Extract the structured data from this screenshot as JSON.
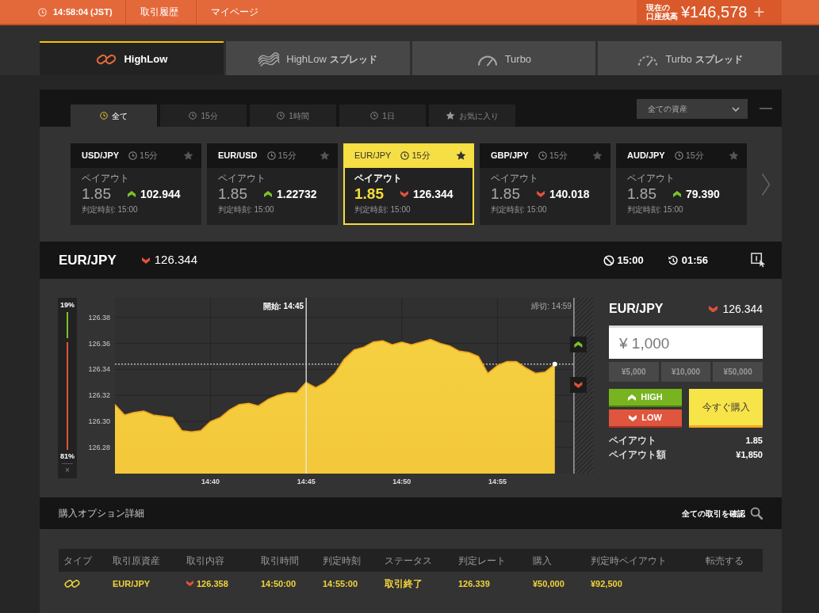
{
  "top_bar": {
    "time": "14:58:04 (JST)",
    "links": [
      "取引履歴",
      "マイページ"
    ],
    "balance": {
      "label_lines": [
        "現在の",
        "口座残高"
      ],
      "amount": "¥146,578",
      "add": "+"
    }
  },
  "product_tabs": [
    {
      "kind": "highlow",
      "label": "HighLow",
      "selected": true
    },
    {
      "kind": "highlow-spread",
      "label": "HighLow",
      "suffix": "スプレッド",
      "selected": false
    },
    {
      "kind": "turbo",
      "label": "Turbo",
      "selected": false
    },
    {
      "kind": "turbo-spread",
      "label": "Turbo",
      "suffix": "スプレッド",
      "selected": false
    }
  ],
  "filter": {
    "tabs": [
      {
        "kind": "clock",
        "label": "全て",
        "selected": true
      },
      {
        "kind": "clock",
        "label": "15分",
        "selected": false
      },
      {
        "kind": "clock",
        "label": "1時間",
        "selected": false
      },
      {
        "kind": "clock",
        "label": "1日",
        "selected": false
      },
      {
        "kind": "star",
        "label": "お気に入り",
        "selected": false
      }
    ],
    "asset_select": "全ての資産"
  },
  "cards": [
    {
      "pair": "USD/JPY",
      "duration": "15分",
      "payout_label": "ペイアウト",
      "payout": "1.85",
      "rising": true,
      "rate": "102.944",
      "expiry": "判定時刻: 15:00",
      "selected": false
    },
    {
      "pair": "EUR/USD",
      "duration": "15分",
      "payout_label": "ペイアウト",
      "payout": "1.85",
      "rising": true,
      "rate": "1.22732",
      "expiry": "判定時刻: 15:00",
      "selected": false
    },
    {
      "pair": "EUR/JPY",
      "duration": "15分",
      "payout_label": "ペイアウト",
      "payout": "1.85",
      "rising": false,
      "rate": "126.344",
      "expiry": "判定時刻: 15:00",
      "selected": true
    },
    {
      "pair": "GBP/JPY",
      "duration": "15分",
      "payout_label": "ペイアウト",
      "payout": "1.85",
      "rising": false,
      "rate": "140.018",
      "expiry": "判定時刻: 15:00",
      "selected": false
    },
    {
      "pair": "AUD/JPY",
      "duration": "15分",
      "payout_label": "ペイアウト",
      "payout": "1.85",
      "rising": true,
      "rate": "79.390",
      "expiry": "判定時刻: 15:00",
      "selected": false
    }
  ],
  "trade_header": {
    "pair": "EUR/JPY",
    "rising": false,
    "rate": "126.344",
    "expiry": "15:00",
    "remaining": "01:56"
  },
  "sentiment": {
    "high": "19%",
    "low": "81%",
    "level": 0.19,
    "close": "×"
  },
  "chart": {
    "close_label": "締切: 14:59",
    "chart_data": {
      "type": "area",
      "categories": [
        null,
        null,
        null,
        null,
        null,
        null,
        null,
        null,
        null,
        null,
        "14:40",
        null,
        null,
        null,
        null,
        null,
        null,
        null,
        null,
        null,
        "14:45",
        null,
        null,
        null,
        null,
        null,
        null,
        null,
        null,
        null,
        "14:50",
        null,
        null,
        null,
        null,
        null,
        null,
        null,
        null,
        null,
        "14:55",
        null,
        null,
        null,
        null,
        null,
        null,
        null,
        null,
        null,
        null
      ],
      "series": [
        {
          "color": "#f5d040",
          "values": [
            126.313,
            126.305,
            126.307,
            126.308,
            126.305,
            126.304,
            126.303,
            126.293,
            126.292,
            126.293,
            126.3,
            126.303,
            126.309,
            126.313,
            126.314,
            126.312,
            126.317,
            126.32,
            126.322,
            126.322,
            126.33,
            126.326,
            126.33,
            126.337,
            126.348,
            126.355,
            126.357,
            126.361,
            126.362,
            126.359,
            126.361,
            126.359,
            126.361,
            126.363,
            126.36,
            126.358,
            126.354,
            126.353,
            126.35,
            126.337,
            126.343,
            126.346,
            126.346,
            126.341,
            126.337,
            126.338,
            126.344,
            null,
            null,
            null,
            null
          ]
        }
      ],
      "ylim": [
        126.26,
        126.395
      ],
      "yticks": [
        {
          "value": 126.28,
          "label": "126.28"
        },
        {
          "value": 126.3,
          "label": "126.30"
        },
        {
          "value": 126.32,
          "label": "126.32"
        },
        {
          "value": 126.34,
          "label": "126.34"
        },
        {
          "value": 126.36,
          "label": "126.36"
        },
        {
          "value": 126.38,
          "label": "126.38"
        }
      ],
      "grid": true,
      "ref_lines": [
        {
          "axis": "x",
          "value": "14:45",
          "label": "開始: 14:45"
        },
        {
          "axis": "y",
          "value": 126.344
        }
      ]
    }
  },
  "order": {
    "pair": "EUR/JPY",
    "rising": false,
    "rate": "126.344",
    "amount": "¥ 1,000",
    "presets": [
      "¥5,000",
      "¥10,000",
      "¥50,000"
    ],
    "high": "HIGH",
    "low": "LOW",
    "buy": "今すぐ購入",
    "summary": [
      {
        "label": "ペイアウト",
        "value": "1.85"
      },
      {
        "label": "ペイアウト額",
        "value": "¥1,850"
      }
    ]
  },
  "details": {
    "title": "購入オプション詳細",
    "view_all": "全ての取引を確認",
    "columns": [
      "タイプ",
      "取引原資産",
      "取引内容",
      "取引時間",
      "判定時刻",
      "ステータス",
      "判定レート",
      "購入",
      "判定時ペイアウト",
      "転売する"
    ],
    "rows": [
      {
        "asset": "EUR/JPY",
        "rising": false,
        "content": "126.358",
        "trade_time": "14:50:00",
        "expiry_time": "14:55:00",
        "status": "取引終了",
        "expiry_rate": "126.339",
        "purchase": "¥50,000",
        "payout": "¥92,500"
      }
    ]
  }
}
